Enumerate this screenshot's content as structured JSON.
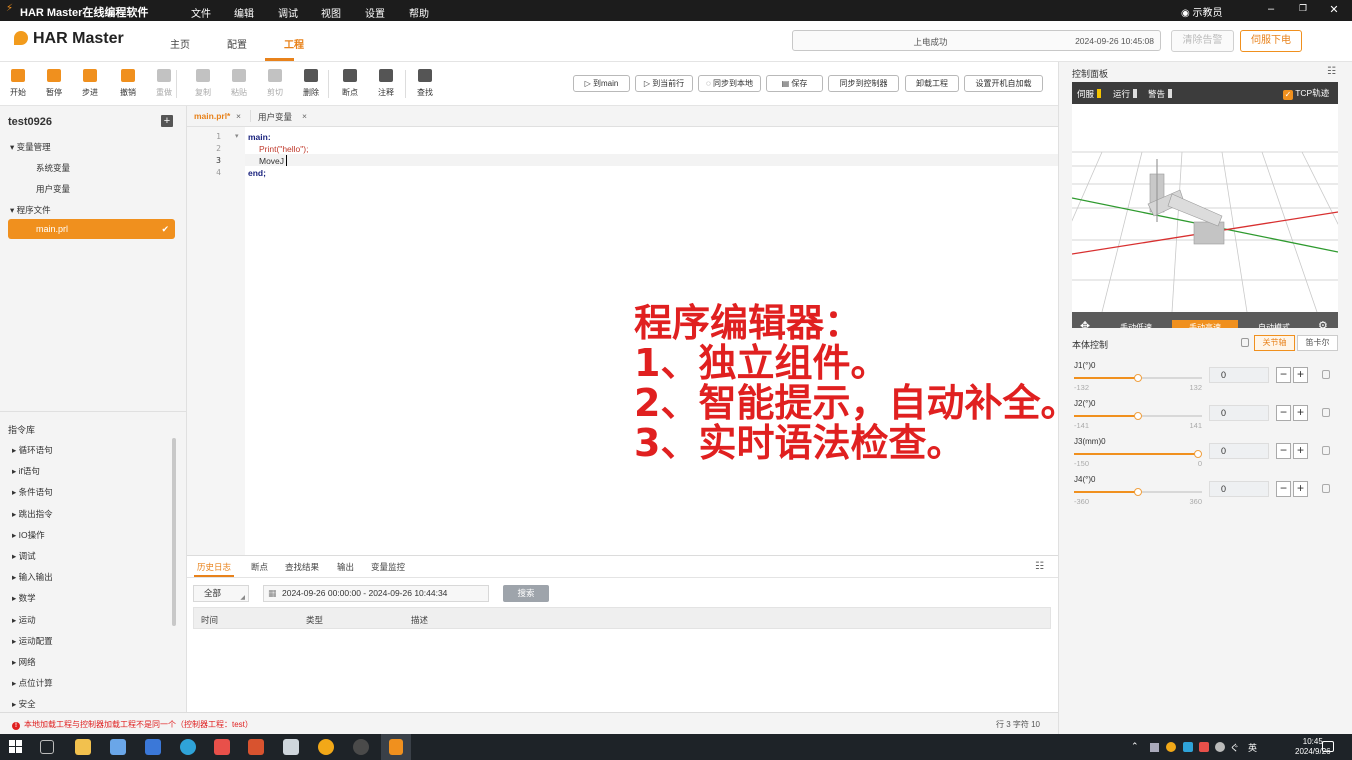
{
  "titlebar": {
    "app_title": "HAR Master在线编程软件",
    "menus": [
      "文件",
      "编辑",
      "调试",
      "视图",
      "设置",
      "帮助"
    ],
    "user": "示教员",
    "controls": [
      "–",
      "❐",
      "✕"
    ]
  },
  "header": {
    "logo_text": "HAR Master",
    "nav_tabs": [
      "主页",
      "配置",
      "工程"
    ],
    "active_tab": "工程",
    "status_message": "上电成功",
    "status_time": "2024-09-26 10:45:08",
    "clear_alarm_label": "清除告警",
    "servo_off_label": "伺服下电"
  },
  "toolbar": {
    "buttons": [
      {
        "label": "开始",
        "icon": "play-icon",
        "color": "#f0901e",
        "enabled": true
      },
      {
        "label": "暂停",
        "icon": "pause-icon",
        "color": "#f0901e",
        "enabled": true
      },
      {
        "label": "步进",
        "icon": "step-icon",
        "color": "#f0901e",
        "enabled": true
      },
      {
        "label": "撤销",
        "icon": "undo-icon",
        "color": "#f0901e",
        "enabled": true
      },
      {
        "label": "重做",
        "icon": "redo-icon",
        "color": "#c2c2c2",
        "enabled": false
      },
      {
        "label": "复制",
        "icon": "copy-icon",
        "color": "#c2c2c2",
        "enabled": false
      },
      {
        "label": "粘贴",
        "icon": "paste-icon",
        "color": "#c2c2c2",
        "enabled": false
      },
      {
        "label": "剪切",
        "icon": "cut-icon",
        "color": "#c2c2c2",
        "enabled": false
      },
      {
        "label": "删除",
        "icon": "delete-icon",
        "color": "#555555",
        "enabled": true
      },
      {
        "label": "断点",
        "icon": "breakpoint-icon",
        "color": "#555555",
        "enabled": true
      },
      {
        "label": "注释",
        "icon": "comment-icon",
        "color": "#555555",
        "enabled": true
      },
      {
        "label": "查找",
        "icon": "find-icon",
        "color": "#555555",
        "enabled": true
      }
    ],
    "right_buttons": [
      "▷ 到main",
      "▷ 到当前行",
      "◌ 同步到本地",
      "▤ 保存",
      "同步到控制器",
      "卸载工程",
      "设置开机自加载"
    ]
  },
  "sidebar": {
    "project_name": "test0926",
    "add_icon": "+",
    "group_vars": "▾  变量管理",
    "sys_vars": "系统变量",
    "user_vars": "用户变量",
    "group_programs": "▾  程序文件",
    "selected_file": "main.prl",
    "check": "✔",
    "library_title": "指令库",
    "library_items": [
      "▸  循环语句",
      "▸  if语句",
      "▸  条件语句",
      "▸  跳出指令",
      "▸  IO操作",
      "▸  调试",
      "▸  输入输出",
      "▸  数学",
      "▸  运动",
      "▸  运动配置",
      "▸  网络",
      "▸  点位计算",
      "▸  安全"
    ]
  },
  "editor": {
    "tabs": [
      {
        "label": "main.prl*",
        "close": "×",
        "active": true
      },
      {
        "label": "用户变量",
        "close": "×",
        "active": false
      }
    ],
    "line_numbers": [
      "1",
      "2",
      "3",
      "4"
    ],
    "fold_marker": "▾",
    "code_lines": [
      "main:",
      "Print(\"hello\");",
      "MoveJ",
      "end;"
    ],
    "annotation": [
      "程序编辑器：",
      "1、独立组件。",
      "2、智能提示，自动补全。",
      "3、实时语法检查。"
    ]
  },
  "bottom_panel": {
    "tabs": [
      "历史日志",
      "断点",
      "查找结果",
      "输出",
      "变量监控"
    ],
    "filter_select": "全部",
    "date_range": "2024-09-26 00:00:00 - 2024-09-26 10:44:34",
    "search_label": "搜索",
    "columns": [
      "时间",
      "类型",
      "描述"
    ]
  },
  "statusbar": {
    "warning_icon": "!",
    "warning": "本地加载工程与控制器加载工程不是同一个（控制器工程：test）",
    "position": "行 3  字符 10"
  },
  "control_panel": {
    "title": "控制面板",
    "menu_icon": "☷",
    "indicators": [
      "伺服",
      "运行",
      "警告"
    ],
    "indicator_colors": [
      "#f5c400",
      "#dddddd",
      "#dddddd"
    ],
    "tcp_label": "TCP轨迹",
    "tcp_checked": true,
    "move_icon": "✥",
    "modes": [
      "手动低速",
      "手动高速",
      "自动模式"
    ],
    "active_mode": "手动高速",
    "settings_icon": "⚙",
    "body_control_title": "本体控制",
    "coord_tabs": [
      "关节轴",
      "笛卡尔"
    ],
    "active_coord": "关节轴",
    "joints": [
      {
        "label": "J1(°)0",
        "min": "-132",
        "max": "132",
        "value": "0",
        "level": 0.5
      },
      {
        "label": "J2(°)0",
        "min": "-141",
        "max": "141",
        "value": "0",
        "level": 0.5
      },
      {
        "label": "J3(mm)0",
        "min": "-150",
        "max": "0",
        "value": "0",
        "level": 1.0
      },
      {
        "label": "J4(°)0",
        "min": "-360",
        "max": "360",
        "value": "0",
        "level": 0.5
      }
    ]
  },
  "taskbar": {
    "tray_text": "⌃",
    "ime": "英",
    "volume": "ぐ",
    "time": "10:45",
    "date": "2024/9/26"
  }
}
